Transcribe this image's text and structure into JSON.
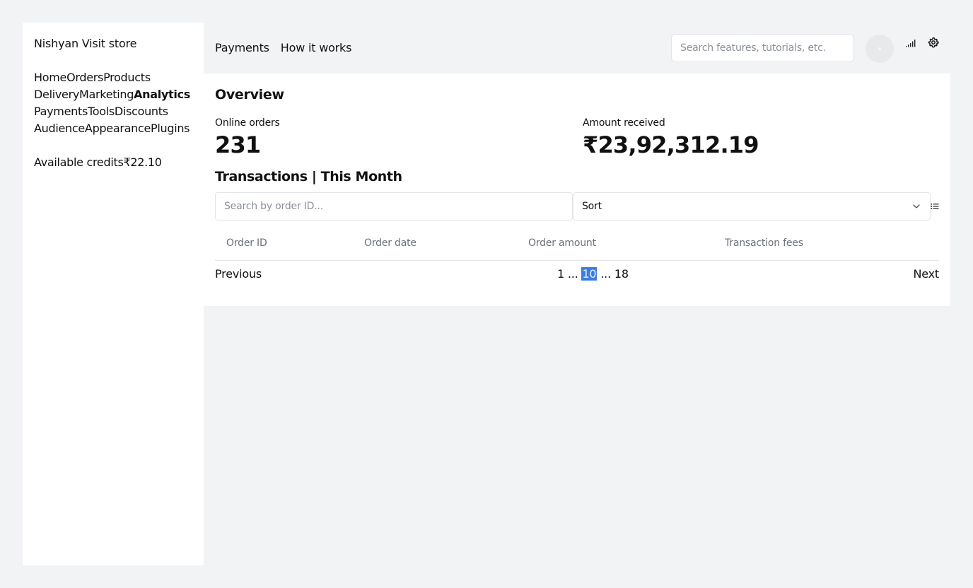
{
  "sidebar": {
    "store_name": "Nishyan Visit store",
    "nav_rows": [
      [
        "Home",
        "Orders",
        "Products"
      ],
      [
        "Delivery",
        "Marketing",
        "Analytics"
      ],
      [
        "Payments",
        "Tools",
        "Discounts"
      ],
      [
        "Audience",
        "Appearance",
        "Plugins"
      ]
    ],
    "active_item": "Analytics",
    "credits_label": "Available credits",
    "credits_value": "₹22.10"
  },
  "header": {
    "nav": [
      "Payments",
      "How it works"
    ],
    "search_placeholder": "Search features, tutorials, etc.",
    "icons": [
      "avatar",
      "signal-icon",
      "gear-icon"
    ]
  },
  "overview": {
    "title": "Overview",
    "online_orders_label": "Online orders",
    "online_orders_value": "231",
    "amount_received_label": "Amount received",
    "amount_received_value": "₹23,92,312.19"
  },
  "transactions": {
    "title": "Transactions | This Month",
    "search_placeholder": "Search by order ID...",
    "sort_label": "Sort",
    "columns": [
      "Order ID",
      "Order date",
      "Order amount",
      "Transaction fees"
    ],
    "rows": []
  },
  "pagination": {
    "previous": "Previous",
    "first": "1",
    "ellipsis": "...",
    "current": "10",
    "last": "18",
    "next": "Next"
  },
  "colors": {
    "page_bg": "#f2f3f5",
    "panel_bg": "#ffffff",
    "current_page_highlight": "#3b7de0",
    "muted_text": "#6b7079"
  }
}
